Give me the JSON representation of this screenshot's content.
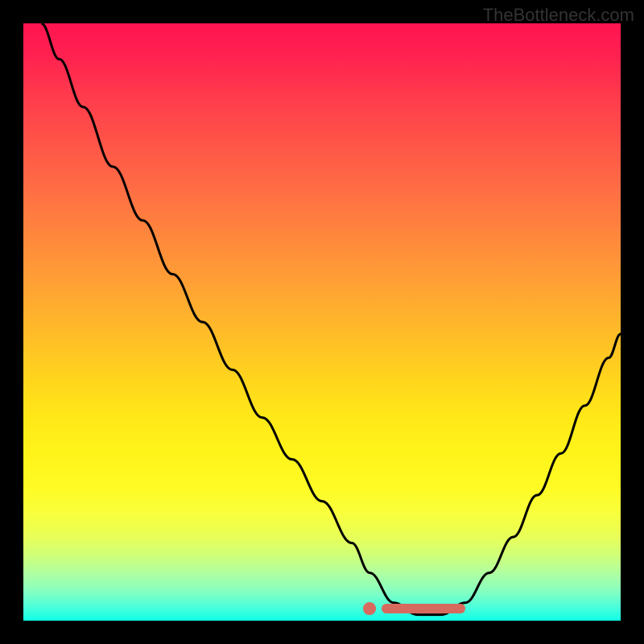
{
  "attribution": "TheBottleneck.com",
  "colors": {
    "background": "#000000",
    "gradient_top": "#ff1450",
    "gradient_bottom": "#10ffe8",
    "curve": "#000000",
    "marker": "#D66A5E"
  },
  "chart_data": {
    "type": "line",
    "title": "",
    "xlabel": "",
    "ylabel": "",
    "xlim": [
      0,
      100
    ],
    "ylim": [
      0,
      100
    ],
    "series": [
      {
        "name": "curve",
        "x": [
          3,
          6,
          10,
          15,
          20,
          25,
          30,
          35,
          40,
          45,
          50,
          55,
          58,
          62,
          66,
          70,
          74,
          78,
          82,
          86,
          90,
          94,
          98,
          100
        ],
        "y": [
          100,
          94,
          86,
          76,
          67,
          58,
          50,
          42,
          34,
          27,
          20,
          13,
          8,
          3,
          1,
          1,
          3,
          8,
          14,
          21,
          28,
          36,
          44,
          48
        ]
      }
    ],
    "marker": {
      "dot_x": 58,
      "bar_x_start": 60,
      "bar_x_end": 74,
      "y": 2
    },
    "background_gradient_axis": "y",
    "background_semantics": "y=100 is red (high bottleneck), y=0 is green (no bottleneck)"
  }
}
